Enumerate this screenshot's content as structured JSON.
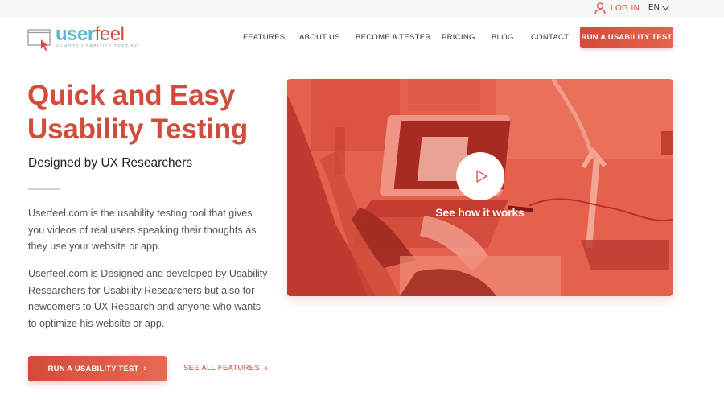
{
  "topbar": {
    "login_label": "LOG IN",
    "language": "EN"
  },
  "logo": {
    "word_part1": "user",
    "word_part2": "feel",
    "tagline": "REMOTE USABILITY TESTING"
  },
  "nav": {
    "items": [
      {
        "label": "FEATURES"
      },
      {
        "label": "ABOUT US"
      },
      {
        "label": "BECOME A TESTER"
      },
      {
        "label": "PRICING"
      },
      {
        "label": "BLOG"
      },
      {
        "label": "CONTACT"
      }
    ],
    "cta_label": "RUN A USABILITY TEST"
  },
  "hero": {
    "title_line1": "Quick and Easy",
    "title_line2": "Usability Testing",
    "subtitle": "Designed by UX Researchers",
    "paragraph1": "Userfeel.com is the usability testing tool that gives you videos of real users speaking their thoughts as they use your website or app.",
    "paragraph2": "Userfeel.com is Designed and developed by Usability Researchers for Usability Researchers but also for newcomers to UX Research and anyone who wants to optimize his website or app.",
    "cta_label": "RUN A USABILITY TEST",
    "secondary_link_label": "SEE ALL FEATURES",
    "chevron": "›"
  },
  "video": {
    "caption": "See how it works"
  },
  "colors": {
    "brand_red": "#d24b3b",
    "brand_teal": "#5bb8cc",
    "topbar_bg": "#f7f7f7"
  }
}
